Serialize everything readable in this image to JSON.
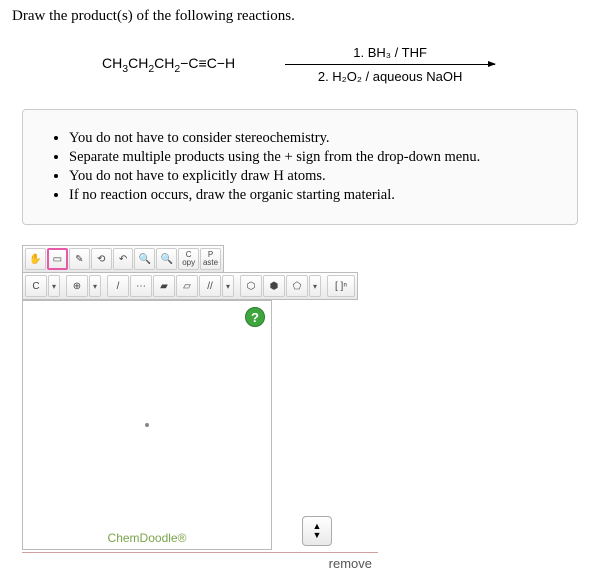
{
  "prompt": "Draw the product(s) of the following reactions.",
  "reaction": {
    "starting_material_html": "CH<sub>3</sub>CH<sub>2</sub>CH<sub>2</sub>−C≡C−H",
    "reagent1": "1. BH₃ / THF",
    "reagent2": "2. H₂O₂ / aqueous NaOH"
  },
  "hints": [
    "You do not have to consider stereochemistry.",
    "Separate multiple products using the + sign from the drop-down menu.",
    "You do not have to explicitly draw H atoms.",
    "If no reaction occurs, draw the organic starting material."
  ],
  "toolbar1": {
    "hand": "✋",
    "rect": "▭",
    "pencil": "✎",
    "lasso": "⟲",
    "undo": "↶",
    "zoom_in": "🔍+",
    "zoom_out": "🔍−",
    "copy": "C\nopy",
    "paste": "P\naste"
  },
  "toolbar2": {
    "element": "C",
    "plus": "⊕",
    "single": "/",
    "dashbond": "⋯",
    "wedge": "▰",
    "hash": "▱",
    "dbl": "//",
    "hex": "⬡",
    "hexfill": "⬢",
    "pent": "⬠",
    "bracket": "[ ]ⁿ"
  },
  "editor": {
    "help": "?",
    "brand": "ChemDoodle®",
    "stepper_up": "▲",
    "stepper_down": "▼",
    "remove": "remove"
  }
}
